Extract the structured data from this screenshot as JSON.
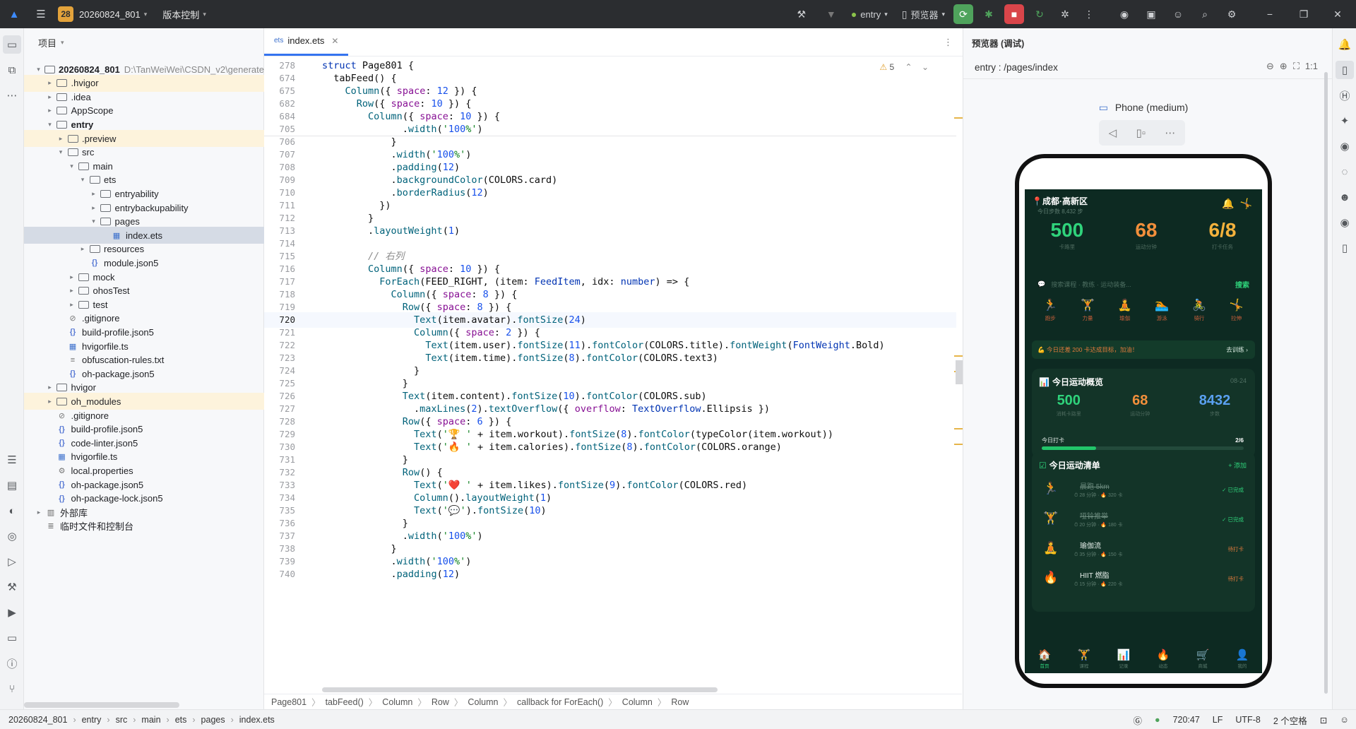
{
  "titlebar": {
    "project_badge": "28",
    "project_name": "20260824_801",
    "vcs_label": "版本控制",
    "run_config": "entry",
    "device": "预览器"
  },
  "project_panel": {
    "title": "项目",
    "items": [
      {
        "label": "20260824_801",
        "path": "D:\\TanWeiWei\\CSDN_v2\\generate",
        "depth": 0,
        "arrow": "▾",
        "icon": "folder",
        "bold": true,
        "hl": false
      },
      {
        "label": ".hvigor",
        "depth": 1,
        "arrow": "▸",
        "icon": "folder",
        "hl": true
      },
      {
        "label": ".idea",
        "depth": 1,
        "arrow": "▸",
        "icon": "folder",
        "hl": false
      },
      {
        "label": "AppScope",
        "depth": 1,
        "arrow": "▸",
        "icon": "folder",
        "hl": false
      },
      {
        "label": "entry",
        "depth": 1,
        "arrow": "▾",
        "icon": "folder",
        "bold": true,
        "hl": false
      },
      {
        "label": ".preview",
        "depth": 2,
        "arrow": "▸",
        "icon": "folder",
        "hl": true
      },
      {
        "label": "src",
        "depth": 2,
        "arrow": "▾",
        "icon": "folder",
        "hl": false
      },
      {
        "label": "main",
        "depth": 3,
        "arrow": "▾",
        "icon": "folder",
        "hl": false
      },
      {
        "label": "ets",
        "depth": 4,
        "arrow": "▾",
        "icon": "folder",
        "hl": false
      },
      {
        "label": "entryability",
        "depth": 5,
        "arrow": "▸",
        "icon": "folder",
        "hl": false
      },
      {
        "label": "entrybackupability",
        "depth": 5,
        "arrow": "▸",
        "icon": "folder",
        "hl": false
      },
      {
        "label": "pages",
        "depth": 5,
        "arrow": "▾",
        "icon": "folder",
        "hl": false
      },
      {
        "label": "index.ets",
        "depth": 6,
        "arrow": "",
        "icon": "ets",
        "sel": true
      },
      {
        "label": "resources",
        "depth": 4,
        "arrow": "▸",
        "icon": "folder",
        "hl": false
      },
      {
        "label": "module.json5",
        "depth": 4,
        "arrow": "",
        "icon": "json",
        "hl": false
      },
      {
        "label": "mock",
        "depth": 3,
        "arrow": "▸",
        "icon": "folder",
        "hl": false
      },
      {
        "label": "ohosTest",
        "depth": 3,
        "arrow": "▸",
        "icon": "folder",
        "hl": false
      },
      {
        "label": "test",
        "depth": 3,
        "arrow": "▸",
        "icon": "folder",
        "hl": false
      },
      {
        "label": ".gitignore",
        "depth": 2,
        "arrow": "",
        "icon": "ignore",
        "hl": false
      },
      {
        "label": "build-profile.json5",
        "depth": 2,
        "arrow": "",
        "icon": "json",
        "hl": false
      },
      {
        "label": "hvigorfile.ts",
        "depth": 2,
        "arrow": "",
        "icon": "ts",
        "hl": false
      },
      {
        "label": "obfuscation-rules.txt",
        "depth": 2,
        "arrow": "",
        "icon": "txt",
        "hl": false
      },
      {
        "label": "oh-package.json5",
        "depth": 2,
        "arrow": "",
        "icon": "json",
        "hl": false
      },
      {
        "label": "hvigor",
        "depth": 1,
        "arrow": "▸",
        "icon": "folder",
        "hl": false
      },
      {
        "label": "oh_modules",
        "depth": 1,
        "arrow": "▸",
        "icon": "folder",
        "hl": true
      },
      {
        "label": ".gitignore",
        "depth": 1,
        "arrow": "",
        "icon": "ignore",
        "hl": false
      },
      {
        "label": "build-profile.json5",
        "depth": 1,
        "arrow": "",
        "icon": "json",
        "hl": false
      },
      {
        "label": "code-linter.json5",
        "depth": 1,
        "arrow": "",
        "icon": "json",
        "hl": false
      },
      {
        "label": "hvigorfile.ts",
        "depth": 1,
        "arrow": "",
        "icon": "ts",
        "hl": false
      },
      {
        "label": "local.properties",
        "depth": 1,
        "arrow": "",
        "icon": "gear",
        "hl": false
      },
      {
        "label": "oh-package.json5",
        "depth": 1,
        "arrow": "",
        "icon": "json",
        "hl": false
      },
      {
        "label": "oh-package-lock.json5",
        "depth": 1,
        "arrow": "",
        "icon": "json",
        "hl": false
      },
      {
        "label": "外部库",
        "depth": 0,
        "arrow": "▸",
        "icon": "lib",
        "hl": false
      },
      {
        "label": "临时文件和控制台",
        "depth": 0,
        "arrow": "",
        "icon": "console",
        "hl": false
      }
    ]
  },
  "editor": {
    "tab_label": "index.ets",
    "warning_count": "5",
    "current_line": "720",
    "lines": [
      {
        "n": "278",
        "code": "struct Page801 {"
      },
      {
        "n": "674",
        "code": "  tabFeed() {"
      },
      {
        "n": "675",
        "code": "    Column({ space: 12 }) {"
      },
      {
        "n": "682",
        "code": "      Row({ space: 10 }) {"
      },
      {
        "n": "684",
        "code": "        Column({ space: 10 }) {"
      },
      {
        "n": "705",
        "code": "              .width('100%')"
      },
      {
        "n": "706",
        "code": "            }"
      },
      {
        "n": "707",
        "code": "            .width('100%')"
      },
      {
        "n": "708",
        "code": "            .padding(12)"
      },
      {
        "n": "709",
        "code": "            .backgroundColor(COLORS.card)"
      },
      {
        "n": "710",
        "code": "            .borderRadius(12)"
      },
      {
        "n": "711",
        "code": "          })"
      },
      {
        "n": "712",
        "code": "        }"
      },
      {
        "n": "713",
        "code": "        .layoutWeight(1)"
      },
      {
        "n": "714",
        "code": ""
      },
      {
        "n": "715",
        "code": "        // 右列"
      },
      {
        "n": "716",
        "code": "        Column({ space: 10 }) {"
      },
      {
        "n": "717",
        "code": "          ForEach(FEED_RIGHT, (item: FeedItem, idx: number) => {"
      },
      {
        "n": "718",
        "code": "            Column({ space: 8 }) {"
      },
      {
        "n": "719",
        "code": "              Row({ space: 8 }) {"
      },
      {
        "n": "720",
        "code": "                Text(item.avatar).fontSize(24)"
      },
      {
        "n": "721",
        "code": "                Column({ space: 2 }) {"
      },
      {
        "n": "722",
        "code": "                  Text(item.user).fontSize(11).fontColor(COLORS.title).fontWeight(FontWeight.Bold)"
      },
      {
        "n": "723",
        "code": "                  Text(item.time).fontSize(8).fontColor(COLORS.text3)"
      },
      {
        "n": "724",
        "code": "                }"
      },
      {
        "n": "725",
        "code": "              }"
      },
      {
        "n": "726",
        "code": "              Text(item.content).fontSize(10).fontColor(COLORS.sub)"
      },
      {
        "n": "727",
        "code": "                .maxLines(2).textOverflow({ overflow: TextOverflow.Ellipsis })"
      },
      {
        "n": "728",
        "code": "              Row({ space: 6 }) {"
      },
      {
        "n": "729",
        "code": "                Text('🏆 ' + item.workout).fontSize(8).fontColor(typeColor(item.workout))"
      },
      {
        "n": "730",
        "code": "                Text('🔥 ' + item.calories).fontSize(8).fontColor(COLORS.orange)"
      },
      {
        "n": "731",
        "code": "              }"
      },
      {
        "n": "732",
        "code": "              Row() {"
      },
      {
        "n": "733",
        "code": "                Text('❤️ ' + item.likes).fontSize(9).fontColor(COLORS.red)"
      },
      {
        "n": "734",
        "code": "                Column().layoutWeight(1)"
      },
      {
        "n": "735",
        "code": "                Text('💬').fontSize(10)"
      },
      {
        "n": "736",
        "code": "              }"
      },
      {
        "n": "737",
        "code": "              .width('100%')"
      },
      {
        "n": "738",
        "code": "            }"
      },
      {
        "n": "739",
        "code": "            .width('100%')"
      },
      {
        "n": "740",
        "code": "            .padding(12)"
      }
    ],
    "breadcrumb": [
      "Page801",
      "tabFeed()",
      "Column",
      "Row",
      "Column",
      "callback for ForEach()",
      "Column",
      "Row"
    ]
  },
  "previewer": {
    "title": "预览器 (调试)",
    "path": "entry : /pages/index",
    "device_label": "Phone (medium)",
    "app": {
      "location": "📍成都·高新区",
      "subtitle": "今日步数 8,432 步",
      "stats": [
        {
          "value": "500",
          "label": "卡路里",
          "color": "#2fd37b"
        },
        {
          "value": "68",
          "label": "运动分钟",
          "color": "#f28f3b"
        },
        {
          "value": "6/8",
          "label": "打卡任务",
          "color": "#f5b23c"
        }
      ],
      "search_placeholder": "搜索课程 · 教练 · 运动装备...",
      "search_button": "搜索",
      "categories": [
        {
          "icon": "🏃",
          "label": "跑步"
        },
        {
          "icon": "🏋",
          "label": "力量"
        },
        {
          "icon": "🧘",
          "label": "瑜伽"
        },
        {
          "icon": "🏊",
          "label": "游泳"
        },
        {
          "icon": "🚴",
          "label": "骑行"
        },
        {
          "icon": "🤸",
          "label": "拉伸"
        }
      ],
      "banner_text": "💪 今日还差 200 卡达成目标，加油！",
      "banner_link": "去训练 ›",
      "overview": {
        "title": "今日运动概览",
        "date": "08-24",
        "stats": [
          {
            "value": "500",
            "label": "消耗卡路里",
            "color": "#2fd37b"
          },
          {
            "value": "68",
            "label": "运动分钟",
            "color": "#f28f3b"
          },
          {
            "value": "8432",
            "label": "步数",
            "color": "#5aa0f0"
          }
        ],
        "checkin_label": "今日打卡",
        "checkin_value": "2/6",
        "progress": 0.27
      },
      "tasks": {
        "title": "今日运动清单",
        "add_label": "+ 添加",
        "items": [
          {
            "icon": "🏃",
            "name": "晨跑 5km",
            "meta": "⏱ 28 分钟 · 🔥 320 卡",
            "status": "✓ 已完成",
            "status_color": "#2fd37b",
            "done": true
          },
          {
            "icon": "🏋",
            "name": "哑铃推举",
            "meta": "⏱ 20 分钟 · 🔥 180 卡",
            "status": "✓ 已完成",
            "status_color": "#2fd37b",
            "done": true
          },
          {
            "icon": "🧘",
            "name": "瑜伽流",
            "meta": "⏱ 35 分钟 · 🔥 150 卡",
            "status": "待打卡",
            "status_color": "#e07a3b",
            "done": false
          },
          {
            "icon": "🔥",
            "name": "HIIT 燃脂",
            "meta": "⏱ 15 分钟 · 🔥 220 卡",
            "status": "待打卡",
            "status_color": "#e07a3b",
            "done": false
          }
        ]
      },
      "nav": [
        {
          "icon": "🏠",
          "label": "首页",
          "active": true
        },
        {
          "icon": "🏋",
          "label": "课程",
          "active": false
        },
        {
          "icon": "📊",
          "label": "记录",
          "active": false
        },
        {
          "icon": "🔥",
          "label": "动态",
          "active": false
        },
        {
          "icon": "🛒",
          "label": "商城",
          "active": false
        },
        {
          "icon": "👤",
          "label": "我的",
          "active": false
        }
      ]
    }
  },
  "statusbar": {
    "path": [
      "20260824_801",
      "entry",
      "src",
      "main",
      "ets",
      "pages",
      "index.ets"
    ],
    "position": "720:47",
    "line_ending": "LF",
    "encoding": "UTF-8",
    "indent": "2 个空格"
  }
}
